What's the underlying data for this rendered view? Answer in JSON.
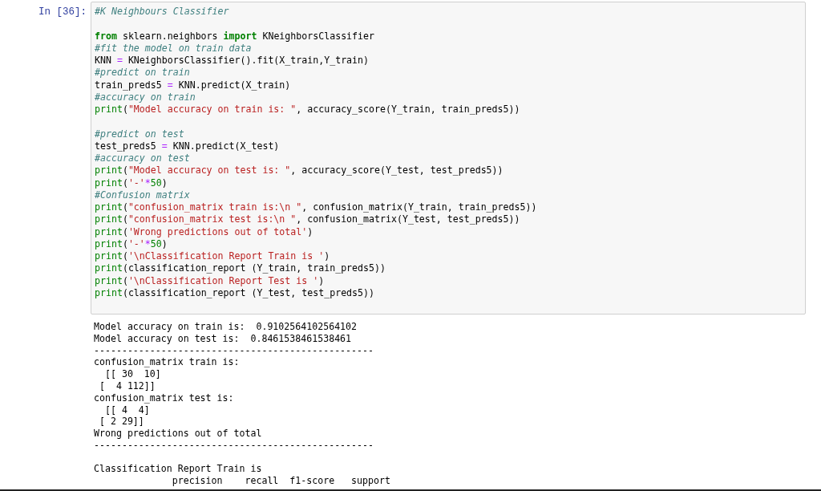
{
  "cell": {
    "prompt": "In [36]:",
    "code": [
      [
        {
          "kind": "comment",
          "text": "#K Neighbours Classifier"
        }
      ],
      [
        {
          "kind": "keyword",
          "text": "from",
          "gap_before": true
        },
        {
          "kind": "plain",
          "text": " sklearn.neighbors "
        },
        {
          "kind": "keyword",
          "text": "import"
        },
        {
          "kind": "plain",
          "text": " KNeighborsClassifier"
        }
      ],
      [
        {
          "kind": "comment",
          "text": "#fit the model on train data"
        }
      ],
      [
        {
          "kind": "plain",
          "text": "KNN "
        },
        {
          "kind": "operator",
          "text": "="
        },
        {
          "kind": "plain",
          "text": " KNeighborsClassifier().fit(X_train,Y_train)"
        }
      ],
      [
        {
          "kind": "comment",
          "text": "#predict on train"
        }
      ],
      [
        {
          "kind": "plain",
          "text": "train_preds5 "
        },
        {
          "kind": "operator",
          "text": "="
        },
        {
          "kind": "plain",
          "text": " KNN.predict(X_train)"
        }
      ],
      [
        {
          "kind": "comment",
          "text": "#accuracy on train"
        }
      ],
      [
        {
          "kind": "builtin",
          "text": "print"
        },
        {
          "kind": "plain",
          "text": "("
        },
        {
          "kind": "string",
          "text": "\"Model accuracy on train is: \""
        },
        {
          "kind": "plain",
          "text": ", accuracy_score(Y_train, train_preds5))"
        }
      ],
      [
        {
          "kind": "comment",
          "text": "#predict on test",
          "gap_before": true
        }
      ],
      [
        {
          "kind": "plain",
          "text": "test_preds5 "
        },
        {
          "kind": "operator",
          "text": "="
        },
        {
          "kind": "plain",
          "text": " KNN.predict(X_test)"
        }
      ],
      [
        {
          "kind": "comment",
          "text": "#accuracy on test"
        }
      ],
      [
        {
          "kind": "builtin",
          "text": "print"
        },
        {
          "kind": "plain",
          "text": "("
        },
        {
          "kind": "string",
          "text": "\"Model accuracy on test is: \""
        },
        {
          "kind": "plain",
          "text": ", accuracy_score(Y_test, test_preds5))"
        }
      ],
      [
        {
          "kind": "builtin",
          "text": "print"
        },
        {
          "kind": "plain",
          "text": "("
        },
        {
          "kind": "string",
          "text": "'-'"
        },
        {
          "kind": "operator",
          "text": "*"
        },
        {
          "kind": "number",
          "text": "50"
        },
        {
          "kind": "plain",
          "text": ")"
        }
      ],
      [
        {
          "kind": "comment",
          "text": "#Confusion matrix"
        }
      ],
      [
        {
          "kind": "builtin",
          "text": "print"
        },
        {
          "kind": "plain",
          "text": "("
        },
        {
          "kind": "string",
          "text": "\"confusion_matrix train is:\\n \""
        },
        {
          "kind": "plain",
          "text": ", confusion_matrix(Y_train, train_preds5))"
        }
      ],
      [
        {
          "kind": "builtin",
          "text": "print"
        },
        {
          "kind": "plain",
          "text": "("
        },
        {
          "kind": "string",
          "text": "\"confusion_matrix test is:\\n \""
        },
        {
          "kind": "plain",
          "text": ", confusion_matrix(Y_test, test_preds5))"
        }
      ],
      [
        {
          "kind": "builtin",
          "text": "print"
        },
        {
          "kind": "plain",
          "text": "("
        },
        {
          "kind": "string",
          "text": "'Wrong predictions out of total'"
        },
        {
          "kind": "plain",
          "text": ")"
        }
      ],
      [
        {
          "kind": "builtin",
          "text": "print"
        },
        {
          "kind": "plain",
          "text": "("
        },
        {
          "kind": "string",
          "text": "'-'"
        },
        {
          "kind": "operator",
          "text": "*"
        },
        {
          "kind": "number",
          "text": "50"
        },
        {
          "kind": "plain",
          "text": ")"
        }
      ],
      [
        {
          "kind": "builtin",
          "text": "print"
        },
        {
          "kind": "plain",
          "text": "("
        },
        {
          "kind": "string",
          "text": "'\\nClassification Report Train is '"
        },
        {
          "kind": "plain",
          "text": ")"
        }
      ],
      [
        {
          "kind": "builtin",
          "text": "print"
        },
        {
          "kind": "plain",
          "text": "(classification_report (Y_train, train_preds5))"
        }
      ],
      [
        {
          "kind": "builtin",
          "text": "print"
        },
        {
          "kind": "plain",
          "text": "("
        },
        {
          "kind": "string",
          "text": "'\\nClassification Report Test is '"
        },
        {
          "kind": "plain",
          "text": ")"
        }
      ],
      [
        {
          "kind": "builtin",
          "text": "print"
        },
        {
          "kind": "plain",
          "text": "(classification_report (Y_test, test_preds5))"
        }
      ]
    ],
    "output": [
      "Model accuracy on train is:  0.9102564102564102",
      "Model accuracy on test is:  0.8461538461538461",
      "--------------------------------------------------",
      "confusion_matrix train is:",
      "  [[ 30  10]",
      " [  4 112]]",
      "confusion_matrix test is:",
      "  [[ 4  4]",
      " [ 2 29]]",
      "Wrong predictions out of total",
      "--------------------------------------------------",
      {
        "text": "Classification Report Train is ",
        "gap_before": true
      },
      "              precision    recall  f1-score   support"
    ]
  }
}
